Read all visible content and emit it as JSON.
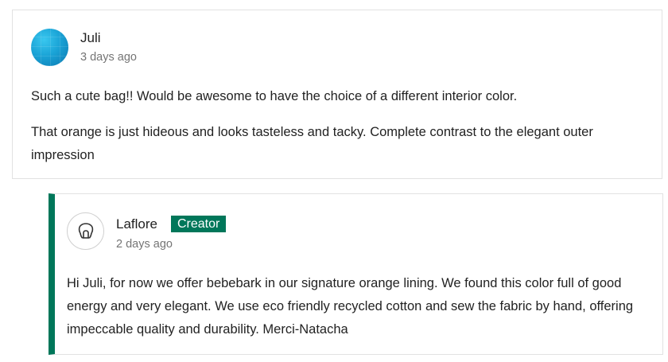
{
  "comment": {
    "author": "Juli",
    "timestamp": "3 days ago",
    "paragraphs": [
      "Such a cute bag!! Would be awesome to have the choice of a different interior color.",
      "That orange is just hideous and looks tasteless and tacky. Complete contrast to the elegant outer impression"
    ]
  },
  "reply": {
    "author": "Laflore",
    "badge": "Creator",
    "timestamp": "2 days ago",
    "text": "Hi Juli, for now we offer bebebark in our signature orange lining. We found this color full of good energy and very elegant. We use eco friendly recycled cotton and sew the fabric by hand, offering impeccable quality and durability. Merci-Natacha"
  },
  "colors": {
    "accent": "#00775a",
    "text": "#222222",
    "muted": "#757575",
    "border": "#e2e2e2"
  }
}
